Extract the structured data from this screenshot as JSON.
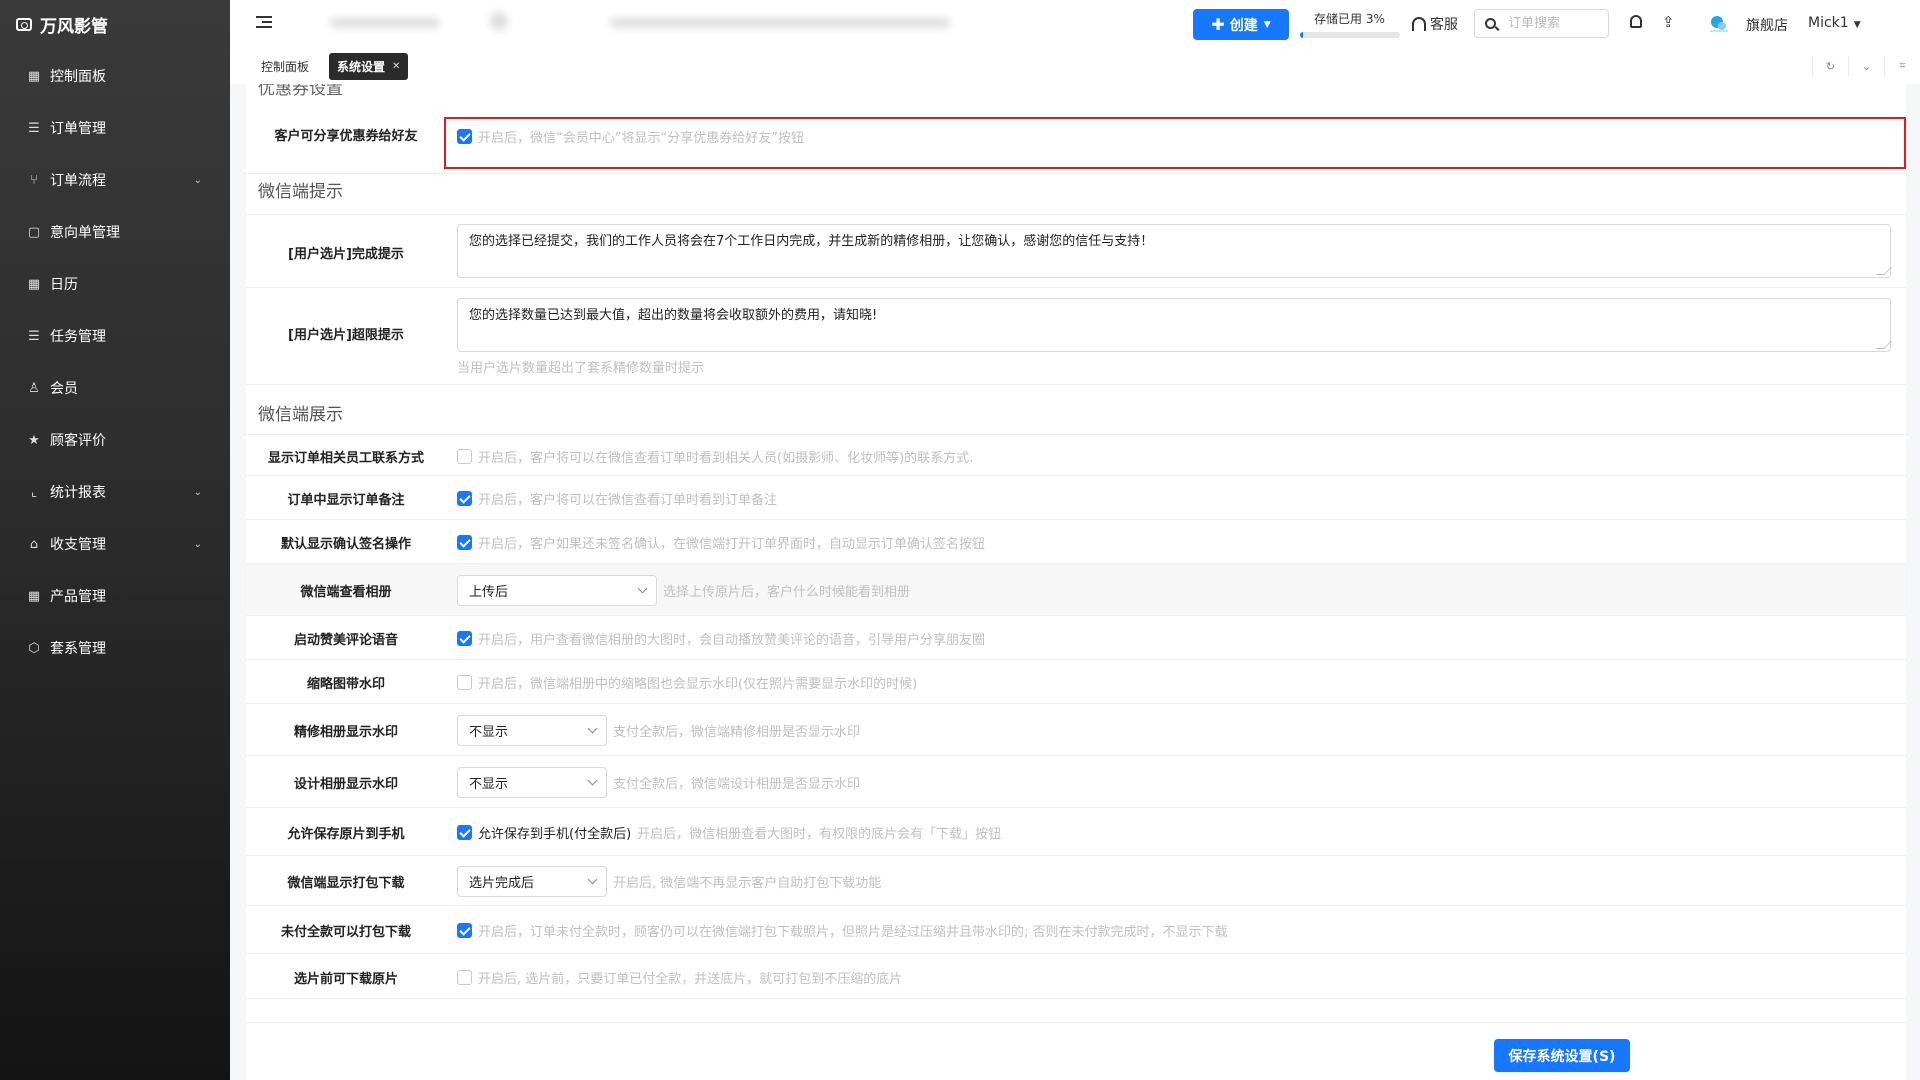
{
  "app": {
    "brand": "万风影管"
  },
  "sidebar": {
    "items": [
      {
        "label": "控制面板",
        "icon": "grid-icon",
        "has_children": false
      },
      {
        "label": "订单管理",
        "icon": "list-icon",
        "has_children": false
      },
      {
        "label": "订单流程",
        "icon": "flow-icon",
        "has_children": true
      },
      {
        "label": "意向单管理",
        "icon": "file-icon",
        "has_children": false
      },
      {
        "label": "日历",
        "icon": "calendar-icon",
        "has_children": false
      },
      {
        "label": "任务管理",
        "icon": "task-icon",
        "has_children": false
      },
      {
        "label": "会员",
        "icon": "user-icon",
        "has_children": false
      },
      {
        "label": "顾客评价",
        "icon": "star-icon",
        "has_children": false
      },
      {
        "label": "统计报表",
        "icon": "chart-icon",
        "has_children": true
      },
      {
        "label": "收支管理",
        "icon": "bank-icon",
        "has_children": true
      },
      {
        "label": "产品管理",
        "icon": "product-icon",
        "has_children": false
      },
      {
        "label": "套系管理",
        "icon": "package-icon",
        "has_children": false
      }
    ]
  },
  "header": {
    "create_label": "创建",
    "storage_label": "存储已用 3%",
    "storage_percent": 3,
    "service_label": "客服",
    "search_placeholder": "订单搜索",
    "store_label": "旗舰店",
    "user_label": "Mick1"
  },
  "tabs": [
    {
      "label": "控制面板",
      "active": false
    },
    {
      "label": "系统设置",
      "active": true
    }
  ],
  "content": {
    "partial_section_title": "优惠券设置",
    "coupon_row": {
      "label": "客户可分享优惠券给好友",
      "checked": true,
      "hint": "开启后，微信“会员中心”将显示“分享优惠券给好友”按钮"
    },
    "section_wechat_tips": "微信端提示",
    "complete_tip": {
      "label": "[用户选片]完成提示",
      "value": "您的选择已经提交，我们的工作人员将会在7个工作日内完成，并生成新的精修相册，让您确认，感谢您的信任与支持！"
    },
    "limit_tip": {
      "label": "[用户选片]超限提示",
      "value": "您的选择数量已达到最大值，超出的数量将会收取额外的费用，请知晓!",
      "hint": "当用户选片数量超出了套系精修数量时提示"
    },
    "section_wechat_display": "微信端展示",
    "rows": [
      {
        "label": "显示订单相关员工联系方式",
        "type": "checkbox",
        "checked": false,
        "hint": "开启后，客户将可以在微信查看订单时看到相关人员(如摄影师、化妆师等)的联系方式."
      },
      {
        "label": "订单中显示订单备注",
        "type": "checkbox",
        "checked": true,
        "hint": "开启后，客户将可以在微信查看订单时看到订单备注"
      },
      {
        "label": "默认显示确认签名操作",
        "type": "checkbox",
        "checked": true,
        "hint": "开启后，客户如果还未签名确认，在微信端打开订单界面时，自动显示订单确认签名按钮"
      },
      {
        "label": "微信端查看相册",
        "type": "select",
        "selected": "上传后",
        "hint": "选择上传原片后，客户什么时候能看到相册"
      },
      {
        "label": "启动赞美评论语音",
        "type": "checkbox",
        "checked": true,
        "hint": "开启后，用户查看微信相册的大图时，会自动播放赞美评论的语音，引导用户分享朋友圈"
      },
      {
        "label": "缩略图带水印",
        "type": "checkbox",
        "checked": false,
        "hint": "开启后，微信端相册中的缩略图也会显示水印(仅在照片需要显示水印的时候)"
      },
      {
        "label": "精修相册显示水印",
        "type": "select",
        "selected": "不显示",
        "hint": "支付全款后，微信端精修相册是否显示水印"
      },
      {
        "label": "设计相册显示水印",
        "type": "select",
        "selected": "不显示",
        "hint": "支付全款后，微信端设计相册是否显示水印"
      },
      {
        "label": "允许保存原片到手机",
        "type": "checkbox",
        "checked": true,
        "inline_label": "允许保存到手机(付全款后)",
        "hint": "开启后，微信相册查看大图时，有权限的底片会有「下载」按钮"
      },
      {
        "label": "微信端显示打包下载",
        "type": "select",
        "selected": "选片完成后",
        "hint": "开启后, 微信端不再显示客户自助打包下载功能"
      },
      {
        "label": "未付全款可以打包下载",
        "type": "checkbox",
        "checked": true,
        "hint": "开启后，订单未付全款时，顾客仍可以在微信端打包下载照片，但照片是经过压缩并且带水印的; 否则在未付款完成时，不显示下载"
      },
      {
        "label": "选片前可下载原片",
        "type": "checkbox",
        "checked": false,
        "hint": "开启后, 选片前，只要订单已付全款，并送底片，就可打包到不压缩的底片"
      }
    ]
  },
  "footer": {
    "save_label": "保存系统设置(S)"
  },
  "colors": {
    "primary": "#1677ff",
    "highlight": "#e41b1b",
    "sidebar_bg": "#2b2b2b"
  }
}
